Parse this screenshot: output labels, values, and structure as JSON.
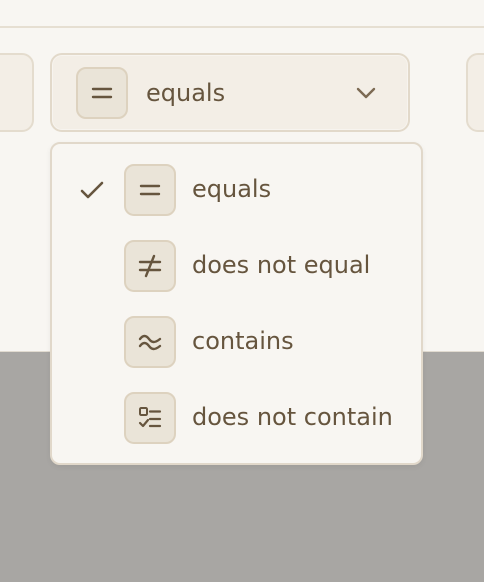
{
  "select": {
    "value": "equals",
    "icon": "equals-icon"
  },
  "dropdown": {
    "options": [
      {
        "label": "equals",
        "icon": "equals-icon",
        "selected": true
      },
      {
        "label": "does not equal",
        "icon": "not-equal-icon",
        "selected": false
      },
      {
        "label": "contains",
        "icon": "approx-icon",
        "selected": false
      },
      {
        "label": "does not contain",
        "icon": "checklist-icon",
        "selected": false
      }
    ]
  },
  "colors": {
    "panel_background": "#f8f6f2",
    "page_background": "#a8a6a3",
    "control_fill": "#f3eee6",
    "control_border": "#e2d9ca",
    "text": "#66553e",
    "icon_box_fill": "#eae4d8",
    "icon_box_border": "#ddd2bf"
  }
}
